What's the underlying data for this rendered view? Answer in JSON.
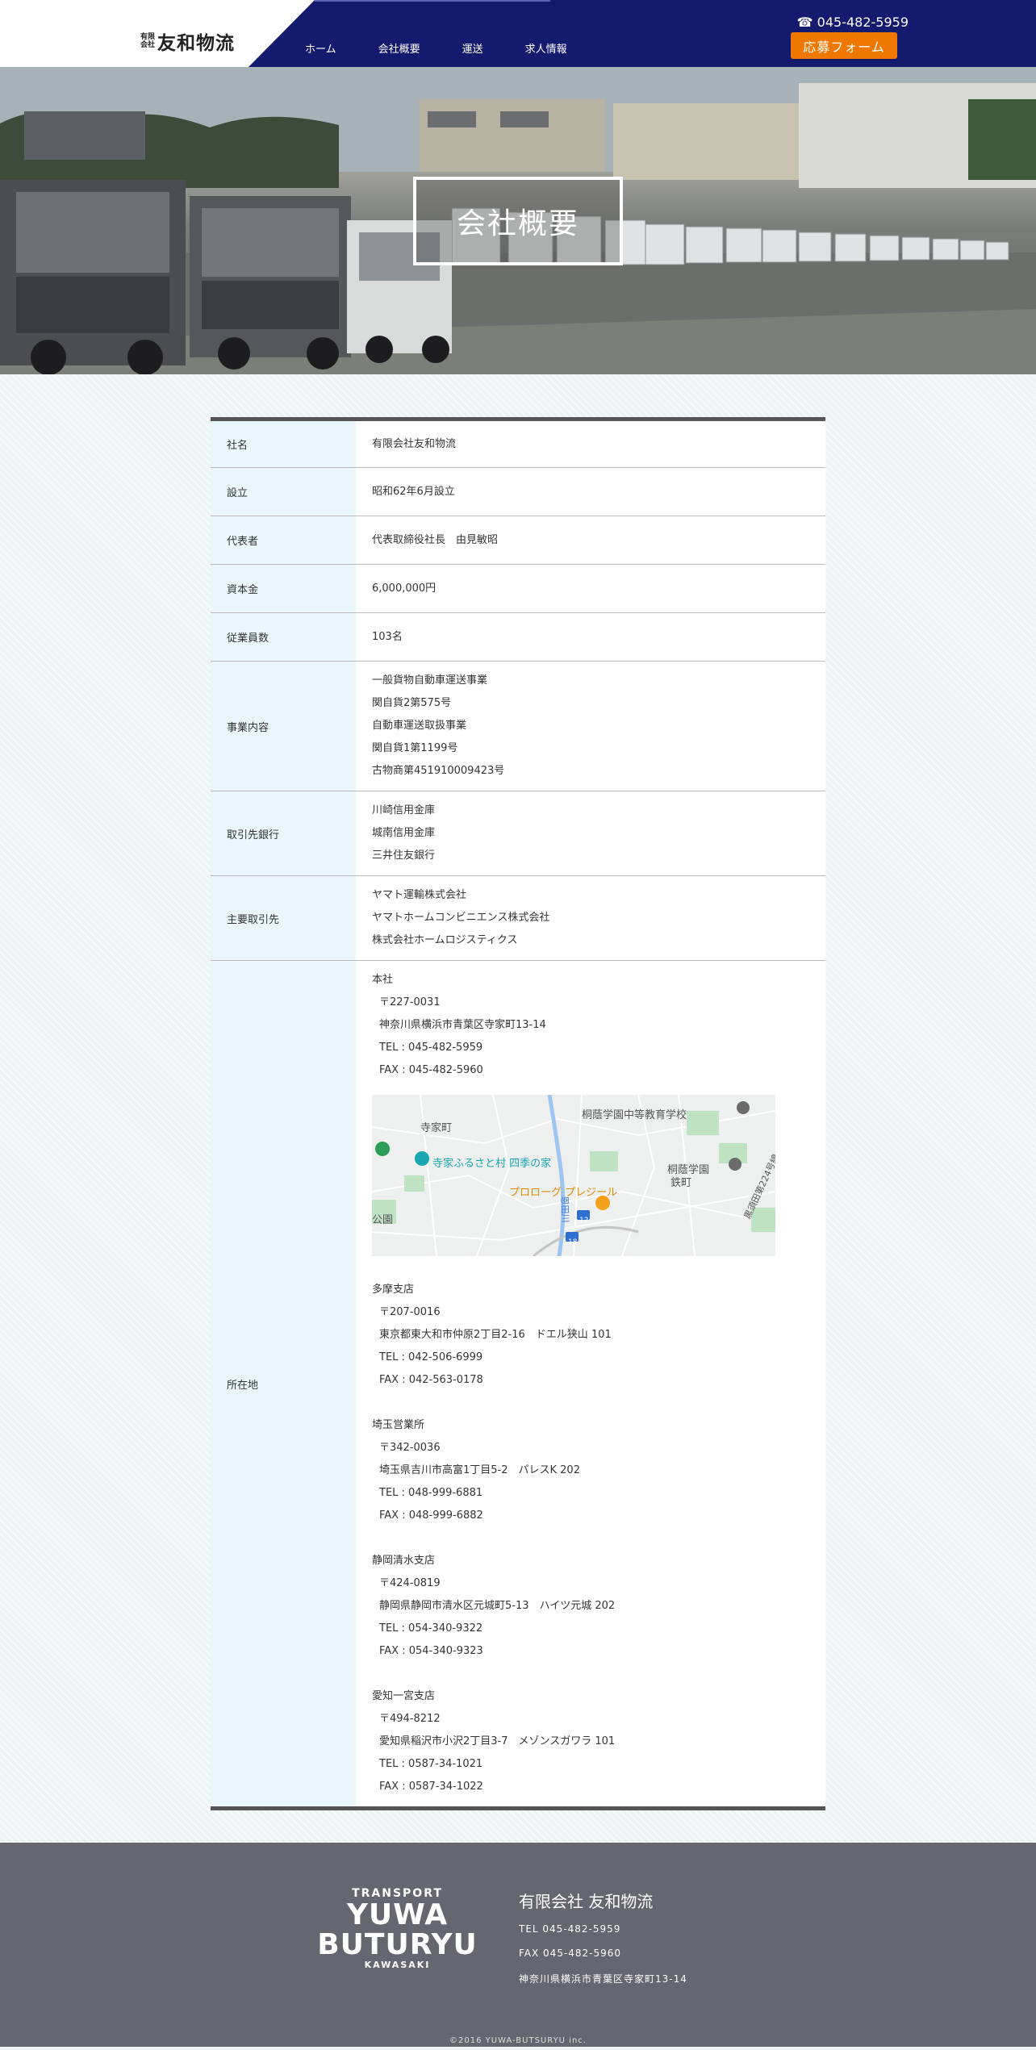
{
  "header": {
    "logo_small_1": "有限",
    "logo_small_2": "会社",
    "logo_name": "友和物流",
    "nav": [
      "ホーム",
      "会社概要",
      "運送",
      "求人情報"
    ],
    "tel": "☎ 045-482-5959",
    "apply_label": "応募フォーム"
  },
  "hero": {
    "title": "会社概要"
  },
  "table": {
    "company_label": "社名",
    "company_value": "有限会社友和物流",
    "founded_label": "設立",
    "founded_value": "昭和62年6月設立",
    "rep_label": "代表者",
    "rep_value": "代表取締役社長　由見敏昭",
    "capital_label": "資本金",
    "capital_value": "6,000,000円",
    "employees_label": "従業員数",
    "employees_value": "103名",
    "business_label": "事業内容",
    "business_lines": [
      "一般貨物自動車運送事業",
      "関自貨2第575号",
      "自動車運送取扱事業",
      "関自貨1第1199号",
      "古物商第451910009423号"
    ],
    "banks_label": "取引先銀行",
    "banks_lines": [
      "川崎信用金庫",
      "城南信用金庫",
      "三井住友銀行"
    ],
    "clients_label": "主要取引先",
    "clients_lines": [
      "ヤマト運輸株式会社",
      "ヤマトホームコンビニエンス株式会社",
      "株式会社ホームロジスティクス"
    ],
    "location_label": "所在地",
    "hq": {
      "name": "本社",
      "zip": "〒227-0031",
      "addr": "神奈川県横浜市青葉区寺家町13-14",
      "tel": "TEL : 045-482-5959",
      "fax": "FAX : 045-482-5960"
    },
    "map": {
      "l1": "桐蔭学園中等教育学校",
      "l2": "寺家町",
      "l3": "寺家ふるさと村 四季の家",
      "l4": "桐蔭学園",
      "l5": "鉄町",
      "l6": "プロローグ プレジール",
      "l7": "黒須田第224号線",
      "l8": "恩田川",
      "l9": "公園",
      "l10": "12",
      "l11": "18"
    },
    "tama": {
      "name": "多摩支店",
      "zip": "〒207-0016",
      "addr": "東京都東大和市仲原2丁目2-16　ドエル狭山 101",
      "tel": "TEL : 042-506-6999",
      "fax": "FAX : 042-563-0178"
    },
    "saitama": {
      "name": "埼玉営業所",
      "zip": "〒342-0036",
      "addr": "埼玉県吉川市高富1丁目5-2　パレスK 202",
      "tel": "TEL : 048-999-6881",
      "fax": "FAX : 048-999-6882"
    },
    "shizuoka": {
      "name": "静岡清水支店",
      "zip": "〒424-0819",
      "addr": "静岡県静岡市清水区元城町5-13　ハイツ元城 202",
      "tel": "TEL : 054-340-9322",
      "fax": "FAX : 054-340-9323"
    },
    "aichi": {
      "name": "愛知一宮支店",
      "zip": "〒494-8212",
      "addr": "愛知県稲沢市小沢2丁目3-7　メゾンスガワラ 101",
      "tel": "TEL : 0587-34-1021",
      "fax": "FAX : 0587-34-1022"
    }
  },
  "footer": {
    "logo_t1": "TRANSPORT",
    "logo_t2": "YUWA",
    "logo_t3": "BUTURYU",
    "logo_t4": "KAWASAKI",
    "company": "有限会社 友和物流",
    "tel": "TEL 045-482-5959",
    "fax": "FAX 045-482-5960",
    "address": "神奈川県横浜市青葉区寺家町13-14",
    "copyright": "©2016 YUWA-BUTSURYU inc."
  },
  "colors": {
    "navy": "#141b6e",
    "orange": "#f07800",
    "label_bg": "#e9f7fd",
    "footer_bg": "#666670"
  }
}
